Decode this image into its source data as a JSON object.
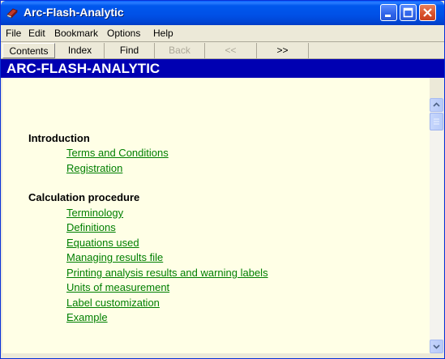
{
  "window": {
    "title": "Arc-Flash-Analytic"
  },
  "menu": [
    "File",
    "Edit",
    "Bookmark",
    "Options",
    "Help"
  ],
  "toolbar": [
    {
      "label": "Contents",
      "enabled": true
    },
    {
      "label": "Index",
      "enabled": true
    },
    {
      "label": "Find",
      "enabled": true
    },
    {
      "label": "Back",
      "enabled": false
    },
    {
      "label": "<<",
      "enabled": false
    },
    {
      "label": ">>",
      "enabled": true
    }
  ],
  "header": {
    "title": "ARC-FLASH-ANALYTIC"
  },
  "sections": [
    {
      "heading": "Introduction",
      "links": [
        "Terms and Conditions",
        "Registration"
      ]
    },
    {
      "heading": "Calculation procedure",
      "links": [
        "Terminology",
        "Definitions",
        "Equations used",
        "Managing results file",
        "Printing  analysis results and warning labels",
        "Units of measurement",
        "Label customization",
        "Example"
      ]
    }
  ],
  "colors": {
    "title_bar": "#0054e3",
    "header_bar": "#0000b2",
    "content_bg": "#ffffe6",
    "link": "#007f00"
  }
}
